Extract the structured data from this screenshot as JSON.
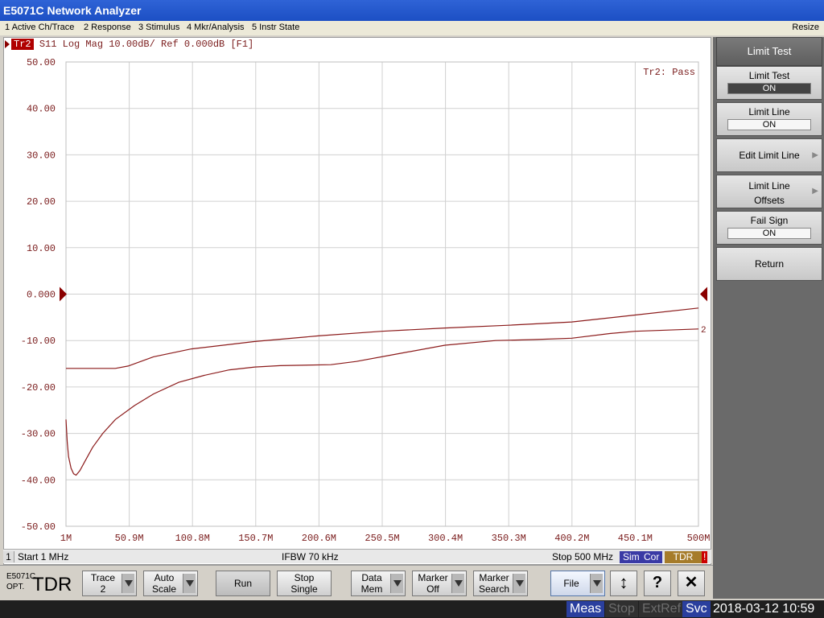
{
  "window": {
    "title": "E5071C Network Analyzer"
  },
  "menu": {
    "items": [
      "1 Active Ch/Trace",
      "2 Response",
      "3 Stimulus",
      "4 Mkr/Analysis",
      "5 Instr State"
    ],
    "resize": "Resize"
  },
  "trace_header": {
    "badge": "Tr2",
    "text": "S11 Log Mag 10.00dB/ Ref 0.000dB [F1]",
    "result": "Tr2: Pass",
    "trace_number": "2"
  },
  "chart_data": {
    "type": "line",
    "xlabel": "",
    "ylabel": "",
    "ylim": [
      -50,
      50
    ],
    "xlim": [
      1,
      500
    ],
    "grid": true,
    "y_ticks": [
      "50.00",
      "40.00",
      "30.00",
      "20.00",
      "10.00",
      "0.000",
      "-10.00",
      "-20.00",
      "-30.00",
      "-40.00",
      "-50.00"
    ],
    "x_ticks": [
      "1M",
      "50.9M",
      "100.8M",
      "150.7M",
      "200.6M",
      "250.5M",
      "300.4M",
      "350.3M",
      "400.2M",
      "450.1M",
      "500M"
    ],
    "series": [
      {
        "name": "",
        "color": "#8b1a1a",
        "points": [
          [
            1,
            -16
          ],
          [
            20,
            -16
          ],
          [
            40,
            -16
          ],
          [
            50,
            -15.5
          ],
          [
            70,
            -13.5
          ],
          [
            100,
            -11.8
          ],
          [
            150,
            -10.2
          ],
          [
            200,
            -9
          ],
          [
            250,
            -8
          ],
          [
            300,
            -7.3
          ],
          [
            350,
            -6.7
          ],
          [
            400,
            -6
          ],
          [
            450,
            -4.5
          ],
          [
            500,
            -3
          ]
        ]
      },
      {
        "name": "",
        "color": "#8b1a1a",
        "points": [
          [
            1,
            -27
          ],
          [
            2,
            -32
          ],
          [
            3,
            -35
          ],
          [
            5,
            -37.5
          ],
          [
            7,
            -38.7
          ],
          [
            9,
            -39
          ],
          [
            12,
            -38
          ],
          [
            16,
            -36
          ],
          [
            22,
            -33
          ],
          [
            30,
            -30
          ],
          [
            40,
            -27
          ],
          [
            55,
            -24
          ],
          [
            70,
            -21.5
          ],
          [
            90,
            -19
          ],
          [
            110,
            -17.5
          ],
          [
            130,
            -16.3
          ],
          [
            150,
            -15.7
          ],
          [
            170,
            -15.4
          ],
          [
            210,
            -15.2
          ],
          [
            230,
            -14.5
          ],
          [
            260,
            -13
          ],
          [
            300,
            -11
          ],
          [
            340,
            -10
          ],
          [
            370,
            -9.8
          ],
          [
            400,
            -9.5
          ],
          [
            430,
            -8.5
          ],
          [
            450,
            -8
          ],
          [
            500,
            -7.5
          ]
        ]
      }
    ]
  },
  "status_bar": {
    "channel": "1",
    "start": "Start 1 MHz",
    "ifbw": "IFBW 70 kHz",
    "stop": "Stop 500 MHz",
    "sim": "Sim",
    "cor": "Cor",
    "tdr": "TDR",
    "warn": "!"
  },
  "softkeys": {
    "title": "Limit Test",
    "limit_test": {
      "label": "Limit Test",
      "value": "ON"
    },
    "limit_line": {
      "label": "Limit Line",
      "value": "ON"
    },
    "edit_limit_line": {
      "label": "Edit Limit Line"
    },
    "limit_line_offsets": {
      "line1": "Limit Line",
      "line2": "Offsets"
    },
    "fail_sign": {
      "label": "Fail Sign",
      "value": "ON"
    },
    "return": {
      "label": "Return"
    }
  },
  "bottom_buttons": {
    "logo_model": "E5071C",
    "logo_opt": "OPT.",
    "logo_tdr": "TDR",
    "trace": [
      "Trace",
      "2"
    ],
    "auto_scale": [
      "Auto",
      "Scale"
    ],
    "run": "Run",
    "stop_single": [
      "Stop",
      "Single"
    ],
    "data_mem": [
      "Data",
      "Mem"
    ],
    "marker_off": [
      "Marker",
      "Off"
    ],
    "marker_search": [
      "Marker",
      "Search"
    ],
    "file": "File",
    "help": "?",
    "close": "✕",
    "updown": "↕"
  },
  "footer": {
    "meas": "Meas",
    "stop": "Stop",
    "extref": "ExtRef",
    "svc": "Svc",
    "datetime": "2018-03-12 10:59"
  }
}
